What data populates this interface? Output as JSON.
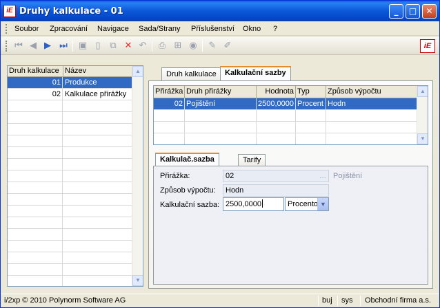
{
  "window": {
    "title": "Druhy kalkulace - 01"
  },
  "menu": [
    "Soubor",
    "Zpracování",
    "Navigace",
    "Sada/Strany",
    "Příslušenství",
    "Okno",
    "?"
  ],
  "left_grid": {
    "headers": [
      "Druh kalkulace",
      "Název"
    ],
    "rows": [
      {
        "code": "01",
        "name": "Produkce",
        "selected": true
      },
      {
        "code": "02",
        "name": "Kalkulace přirážky",
        "selected": false
      }
    ]
  },
  "top_tabs": [
    "Druh kalkulace",
    "Kalkulační sazby"
  ],
  "rates_grid": {
    "headers": [
      "Přirážka",
      "Druh přirážky",
      "Hodnota",
      "Typ",
      "Způsob výpočtu"
    ],
    "rows": [
      {
        "prirazka": "02",
        "druh": "Pojištění",
        "hodnota": "2500,0000",
        "typ": "Procent",
        "zpusob": "Hodn"
      }
    ]
  },
  "sub_tabs": [
    "Kalkulač.sazba",
    "Tarify"
  ],
  "form": {
    "prirazka_label": "Přirážka:",
    "prirazka_value": "02",
    "prirazka_desc": "Pojištění",
    "zpusob_label": "Způsob výpočtu:",
    "zpusob_value": "Hodn",
    "sazba_label": "Kalkulační sazba:",
    "sazba_value": "2500,0000",
    "typ_value": "Procento"
  },
  "status": {
    "copyright": "i/2xp © 2010 Polynorm Software AG",
    "field1": "buj",
    "field2": "sys",
    "company": "Obchodní firma a.s."
  }
}
